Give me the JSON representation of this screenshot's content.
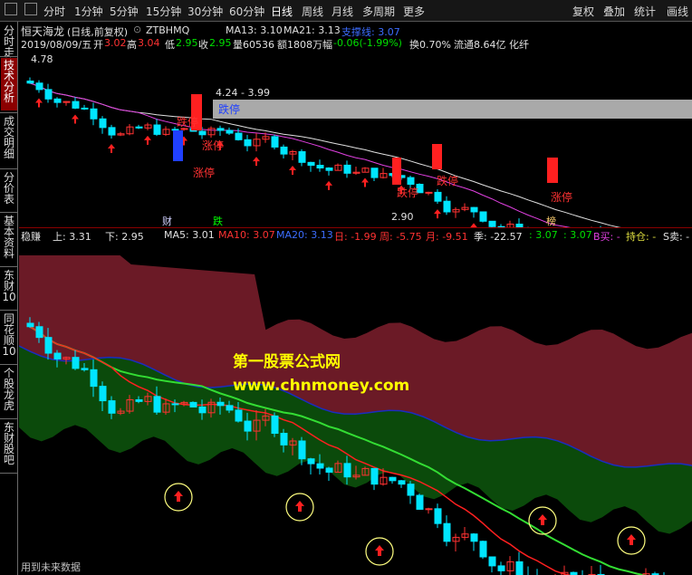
{
  "toolbar": {
    "fenshi": "分时",
    "m1": "1分钟",
    "m5": "5分钟",
    "m15": "15分钟",
    "m30": "30分钟",
    "m60": "60分钟",
    "day": "日线",
    "week": "周线",
    "month": "月线",
    "multi": "多周期",
    "more": "更多",
    "restore": "复权",
    "overlay": "叠加",
    "stats": "统计",
    "draw": "画线"
  },
  "sidebar": [
    "分时走势",
    "技术分析",
    "成交明细",
    "分价表",
    "基本资料",
    "东财10",
    "同花顺10",
    "个股龙虎",
    "东财股吧"
  ],
  "header": {
    "name": "恒天海龙",
    "mode": "(日线,前复权)",
    "code": "ZTBHMQ",
    "ma13": "MA13: 3.10",
    "ma21": "MA21: 3.13",
    "cbx": "支撑线: 3.07"
  },
  "quote": {
    "date": "2019/08/09/五",
    "open_l": "开",
    "open": "3.02",
    "high_l": "高",
    "high": "3.04",
    "low_l": "低",
    "low": "2.95",
    "close_l": "收",
    "close": "2.95",
    "vol": "量60536",
    "amt": "额1808万",
    "chg_l": "幅",
    "chg": "-0.06(-1.99%)",
    "turn": "换0.70%",
    "flow": "流通8.64亿 化纤"
  },
  "upper": {
    "high_label": "4.78",
    "range_label": "4.24 - 3.99",
    "band_label": "跌停",
    "zt": "涨停",
    "dt": "跌停",
    "low_label": "2.90",
    "m_cai": "财",
    "m_die": "跌",
    "m_bang": "榜"
  },
  "lower_header": {
    "name": "稳赚",
    "up": "上: 3.31",
    "down": "下: 2.95",
    "ma5": "MA5: 3.01",
    "ma10": "MA10: 3.07",
    "ma20": "MA20: 3.13",
    "ri": "日: -1.99",
    "zhou": "周: -5.75",
    "yue": "月: -9.51",
    "ji": "季: -22.57",
    "v1": ": 3.07",
    "v2": ": 3.07",
    "b": "B买: -",
    "hold": "持仓: -",
    "s": "S卖: -"
  },
  "watermark": {
    "line1": "第一股票公式网",
    "line2": "www.chnmoney.com"
  },
  "footer": "用到未来数据",
  "colors": {
    "up": "#ff3232",
    "down": "#00e5ff",
    "maroon": "#6b1a26",
    "green": "#0b4a0b"
  }
}
